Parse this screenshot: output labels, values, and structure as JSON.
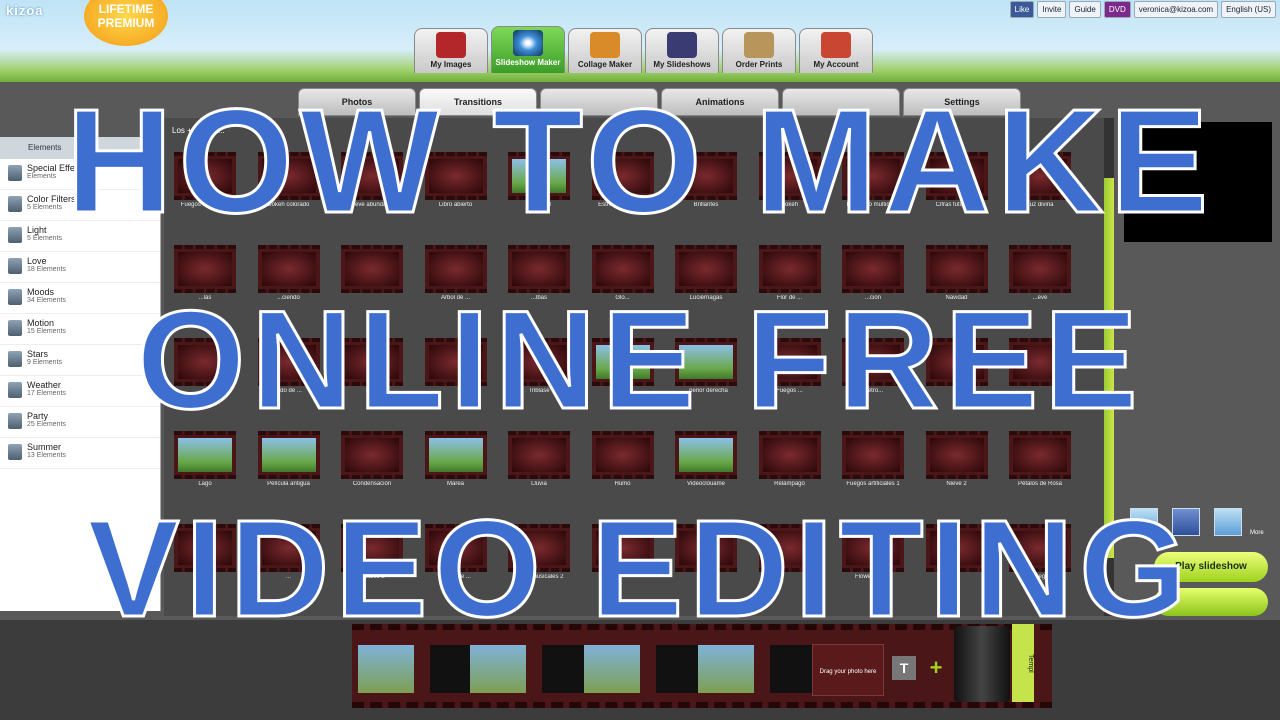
{
  "topbar": {
    "logo": "kizoa",
    "premium_badge": "LIFETIME PREMIUM",
    "account_items": [
      "Like",
      "Invite",
      "Guide",
      "DVD",
      "veronica@kizoa.com",
      "English (US)"
    ]
  },
  "nav_tabs": [
    {
      "label": "My Images",
      "icon": "images-icon",
      "active": false
    },
    {
      "label": "Slideshow Maker",
      "icon": "slideshow-icon",
      "active": true
    },
    {
      "label": "Collage Maker",
      "icon": "collage-icon",
      "active": false
    },
    {
      "label": "My Slideshows",
      "icon": "slideshows-icon",
      "active": false
    },
    {
      "label": "Order Prints",
      "icon": "prints-icon",
      "active": false
    },
    {
      "label": "My Account",
      "icon": "account-icon",
      "active": false
    }
  ],
  "sub_tabs": [
    {
      "label": "Photos",
      "active": false
    },
    {
      "label": "Transitions",
      "active": true
    },
    {
      "label": "",
      "active": false
    },
    {
      "label": "Animations",
      "active": false
    },
    {
      "label": "",
      "active": false
    },
    {
      "label": "Settings",
      "active": false
    }
  ],
  "sidebar": {
    "header": "Elements",
    "items": [
      {
        "label": "Special Effects",
        "count": "Elements"
      },
      {
        "label": "Color Filters",
        "count": "5 Elements"
      },
      {
        "label": "Light",
        "count": "5 Elements"
      },
      {
        "label": "Love",
        "count": "18 Elements"
      },
      {
        "label": "Moods",
        "count": "34 Elements"
      },
      {
        "label": "Motion",
        "count": "15 Elements"
      },
      {
        "label": "Stars",
        "count": "9 Elements"
      },
      {
        "label": "Weather",
        "count": "17 Elements"
      },
      {
        "label": "Party",
        "count": "25 Elements"
      },
      {
        "label": "Summer",
        "count": "13 Elements"
      }
    ]
  },
  "grid": {
    "header": "Los + popula...",
    "rows": [
      [
        "Fuegos artificiales",
        "Bokeh colorado",
        "Nieve abundante",
        "Libro abierto",
        "Earlybird",
        "Estrellas brillantes",
        "Brillantes",
        "Bokeh",
        "Remolino multicolor",
        "Cifras futuristas",
        "Luz divina"
      ],
      [
        "...las",
        "...ciendo",
        "",
        "Árbol de ...",
        "...lbas",
        "Glo...",
        "Luciérnagas",
        "Flor de ...",
        "...ción",
        "Navidad",
        "...eve"
      ],
      [
        "...dad",
        "...do de ...",
        "Pa...",
        "",
        "Triblase",
        "Zoom...",
        "...perior derecha",
        "Fuegos ...",
        "Metro...",
        "",
        ""
      ],
      [
        "Lago",
        "Película antigua",
        "Condensación",
        "Marea",
        "Lluvia",
        "Humo",
        "Videoclouame",
        "Relámpago",
        "Fuegos artificiales 1",
        "Nieve 2",
        "Pétalos de Rosa"
      ],
      [
        "Cora...",
        "...",
        "...ciales 2",
        "Lluvia de ...",
        "Notas musicales 2",
        "",
        "",
        "",
        "Flower Pow...",
        "",
        "Fuego"
      ]
    ]
  },
  "right_panel": {
    "more_label": "More",
    "play_label": "Play slideshow",
    "icons": [
      "photo-icon",
      "facebook-icon",
      "download-icon"
    ]
  },
  "timeline": {
    "drag_label": "Drag your photo here",
    "text_button": "T",
    "add_button": "+",
    "template_tab": "Templ"
  },
  "overlay": {
    "line1": "HOW TO MAKE",
    "line2": "ONLINE FREE",
    "line3": "VIDEO EDITING"
  }
}
